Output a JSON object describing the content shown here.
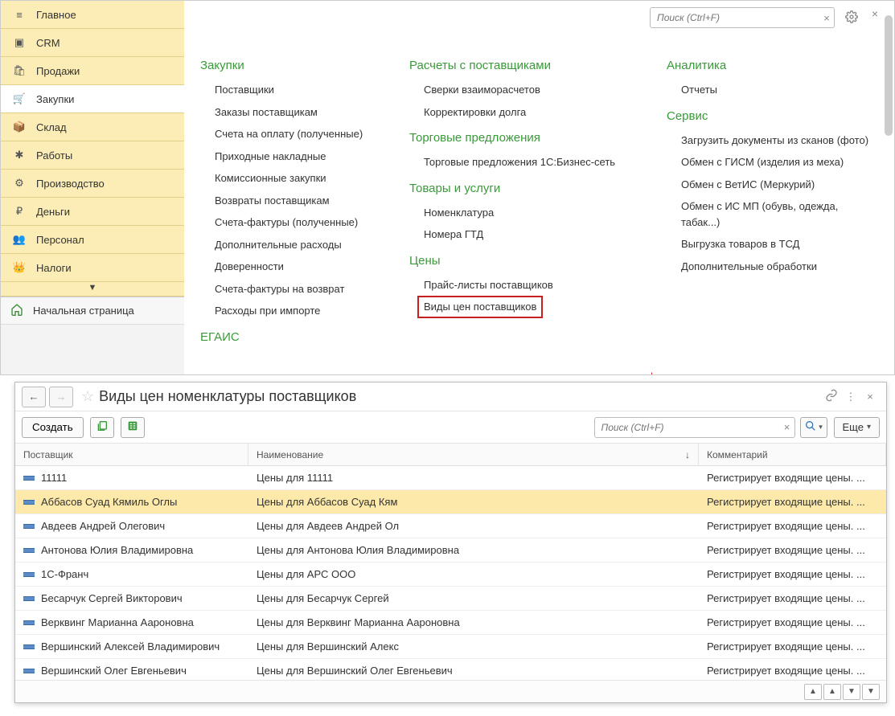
{
  "search": {
    "placeholder": "Поиск (Ctrl+F)"
  },
  "sidebar": {
    "items": [
      {
        "label": "Главное"
      },
      {
        "label": "CRM"
      },
      {
        "label": "Продажи"
      },
      {
        "label": "Закупки"
      },
      {
        "label": "Склад"
      },
      {
        "label": "Работы"
      },
      {
        "label": "Производство"
      },
      {
        "label": "Деньги"
      },
      {
        "label": "Персонал"
      },
      {
        "label": "Налоги"
      }
    ],
    "home": "Начальная страница"
  },
  "sections": {
    "col1a": {
      "title": "Закупки",
      "links": [
        "Поставщики",
        "Заказы поставщикам",
        "Счета на оплату (полученные)",
        "Приходные накладные",
        "Комиссионные закупки",
        "Возвраты поставщикам",
        "Счета-фактуры (полученные)",
        "Дополнительные расходы",
        "Доверенности",
        "Счета-фактуры на возврат",
        "Расходы при импорте"
      ]
    },
    "col1b": {
      "title": "ЕГАИС"
    },
    "col2a": {
      "title": "Расчеты с поставщиками",
      "links": [
        "Сверки взаиморасчетов",
        "Корректировки долга"
      ]
    },
    "col2b": {
      "title": "Торговые предложения",
      "links": [
        "Торговые предложения 1С:Бизнес-сеть"
      ]
    },
    "col2c": {
      "title": "Товары и услуги",
      "links": [
        "Номенклатура",
        "Номера ГТД"
      ]
    },
    "col2d": {
      "title": "Цены",
      "links": [
        "Прайс-листы поставщиков",
        "Виды цен поставщиков"
      ]
    },
    "col3a": {
      "title": "Аналитика",
      "links": [
        "Отчеты"
      ]
    },
    "col3b": {
      "title": "Сервис",
      "links": [
        "Загрузить документы из сканов (фото)",
        "Обмен с ГИСМ (изделия из меха)",
        "Обмен с ВетИС (Меркурий)",
        "Обмен с ИС МП (обувь, одежда, табак...)",
        "Выгрузка товаров в ТСД",
        "Дополнительные обработки"
      ]
    }
  },
  "detail": {
    "title": "Виды цен номенклатуры поставщиков",
    "create": "Создать",
    "more": "Еще",
    "columns": {
      "supplier": "Поставщик",
      "name": "Наименование",
      "comment": "Комментарий"
    },
    "rows": [
      {
        "supplier": "11111",
        "name": "Цены для 11111",
        "comment": "Регистрирует входящие цены. ..."
      },
      {
        "supplier": "Аббасов Суад Кямиль Оглы",
        "name": "Цены для Аббасов Суад Кям",
        "comment": "Регистрирует входящие цены. ..."
      },
      {
        "supplier": "Авдеев Андрей Олегович",
        "name": "Цены для Авдеев Андрей Ол",
        "comment": "Регистрирует входящие цены. ..."
      },
      {
        "supplier": "Антонова Юлия Владимировна",
        "name": "Цены для Антонова Юлия Владимировна",
        "comment": "Регистрирует входящие цены. ..."
      },
      {
        "supplier": "1С-Франч",
        "name": "Цены для АРС ООО",
        "comment": "Регистрирует входящие цены. ..."
      },
      {
        "supplier": "Бесарчук Сергей Викторович",
        "name": "Цены для Бесарчук Сергей",
        "comment": "Регистрирует входящие цены. ..."
      },
      {
        "supplier": "Верквинг Марианна Аароновна",
        "name": "Цены для Верквинг Марианна Аароновна",
        "comment": "Регистрирует входящие цены. ..."
      },
      {
        "supplier": "Вершинский Алексей Владимирович",
        "name": "Цены для Вершинский Алекс",
        "comment": "Регистрирует входящие цены. ..."
      },
      {
        "supplier": "Вершинский Олег Евгеньевич",
        "name": "Цены для Вершинский Олег Евгеньевич",
        "comment": "Регистрирует входящие цены. ..."
      }
    ],
    "selected_row": 1
  }
}
